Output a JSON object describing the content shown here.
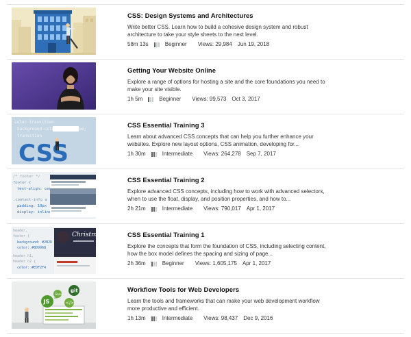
{
  "courses": [
    {
      "title": "CSS: Design Systems and Architectures",
      "description": "Write better CSS. Learn how to build a cohesive design system and robust architecture to take your style sheets to the next level.",
      "duration": "58m 13s",
      "level": "Beginner",
      "level_bars": 1,
      "views": "Views: 29,984",
      "date": "Jun 19, 2018"
    },
    {
      "title": "Getting Your Website Online",
      "description": "Explore a range of options for hosting a site and the core foundations you need to make your site visible.",
      "duration": "1h 5m",
      "level": "Beginner",
      "level_bars": 1,
      "views": "Views: 99,573",
      "date": "Oct 3, 2017"
    },
    {
      "title": "CSS Essential Training 3",
      "description": "Learn about advanced CSS concepts that can help you further enhance your websites. Explore new layout options, CSS animation, developing for...",
      "duration": "1h 30m",
      "level": "Intermediate",
      "level_bars": 2,
      "views": "Views: 264,278",
      "date": "Sep 7, 2017",
      "thumb_code": [
        "color-transition",
        "background-color: lightblue;",
        "transition"
      ],
      "thumb_word": "CSS"
    },
    {
      "title": "CSS Essential Training 2",
      "description": "Explore advanced CSS concepts, including how to work with advanced selectors, when to use the float, display, and position properties, and how to...",
      "duration": "2h 21m",
      "level": "Intermediate",
      "level_bars": 2,
      "views": "Views: 790,017",
      "date": "Apr 1, 2017",
      "thumb_code": [
        "/* footer */",
        "footer {",
        "text-align: cen",
        ".contact-info a",
        "padding: 10px",
        "display: inline"
      ]
    },
    {
      "title": "CSS Essential Training 1",
      "description": "Explore the concepts that form the foundation of CSS, including selecting content, how the box model defines the spacing and sizing of page...",
      "duration": "2h 36m",
      "level": "Beginner",
      "level_bars": 1,
      "views": "Views: 1,605,175",
      "date": "Apr 1, 2017",
      "thumb_code": [
        "header,",
        "footer {",
        "background: #2B2D",
        "color: #8D9968",
        "header h1,",
        "header h2 {",
        "color: #EDF2F4"
      ],
      "thumb_word": "Christmas"
    },
    {
      "title": "Workflow Tools for Web Developers",
      "description": "Learn the tools and frameworks that can make your web development workflow more productive and efficient.",
      "duration": "1h 13m",
      "level": "Intermediate",
      "level_bars": 2,
      "views": "Views: 98,437",
      "date": "Dec 9, 2016",
      "thumb_badges": [
        "JS",
        "Sass",
        "git",
        "</>"
      ]
    }
  ],
  "colors": {
    "title": "#111111",
    "text": "#333333",
    "divider": "#e3e6e8",
    "level_on": "#5a5f63",
    "level_off": "#c9cdd0"
  }
}
